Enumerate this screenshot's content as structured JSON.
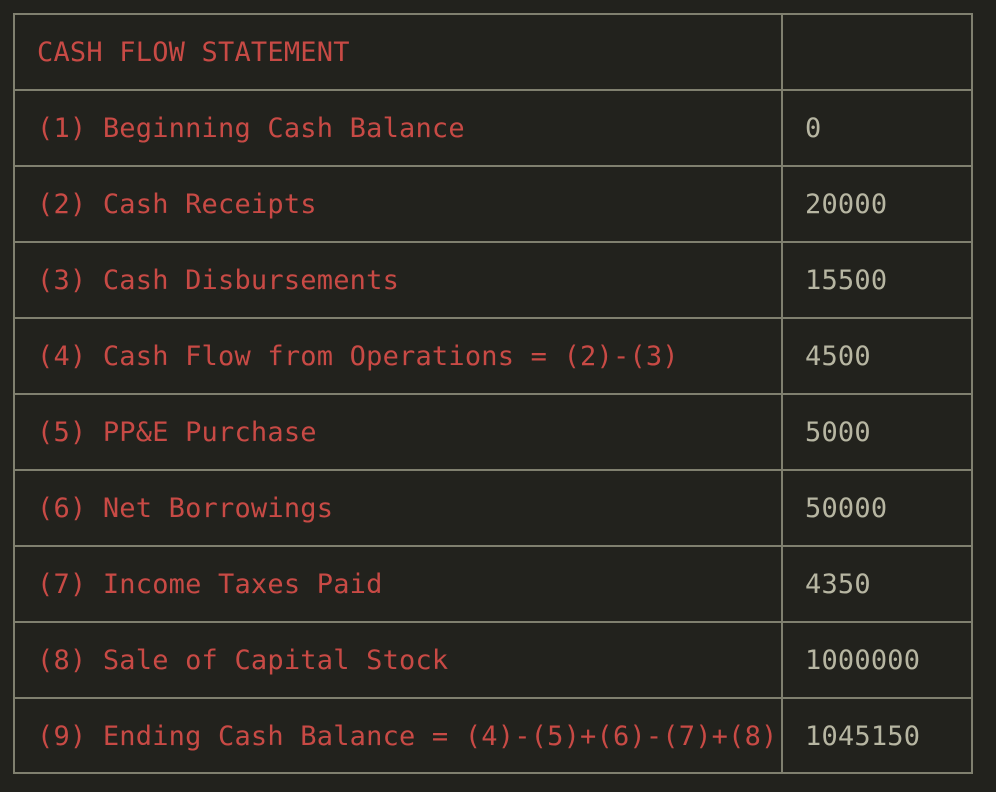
{
  "statement": {
    "title": "CASH FLOW STATEMENT",
    "title_value": "",
    "rows": [
      {
        "label": "(1) Beginning Cash Balance",
        "value": "0"
      },
      {
        "label": "(2) Cash Receipts",
        "value": "20000"
      },
      {
        "label": "(3) Cash Disbursements",
        "value": "15500"
      },
      {
        "label": "(4) Cash Flow from Operations = (2)-(3)",
        "value": "4500"
      },
      {
        "label": "(5) PP&E Purchase",
        "value": "5000"
      },
      {
        "label": "(6) Net Borrowings",
        "value": "50000"
      },
      {
        "label": "(7) Income Taxes Paid",
        "value": "4350"
      },
      {
        "label": "(8) Sale of Capital Stock",
        "value": "1000000"
      },
      {
        "label": "(9) Ending Cash Balance = (4)-(5)+(6)-(7)+(8)",
        "value": "1045150"
      }
    ]
  },
  "colors": {
    "background": "#22221d",
    "grid": "#80806f",
    "label_text": "#c84a45",
    "value_text": "#b7b6a2"
  }
}
